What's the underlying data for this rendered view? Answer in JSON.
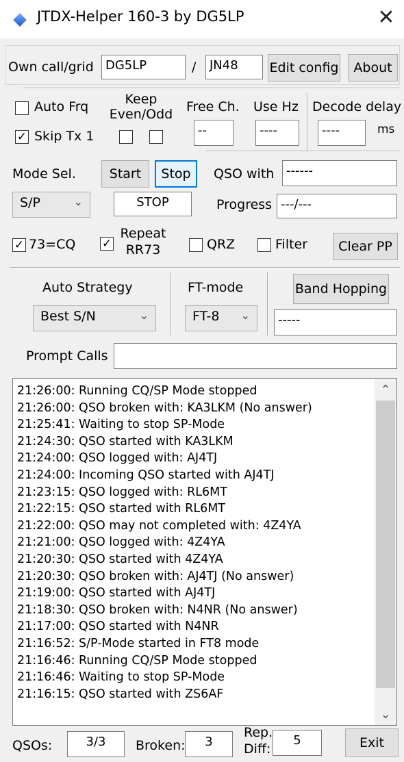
{
  "window": {
    "title": "JTDX-Helper 160-3 by DG5LP",
    "close_glyph": "✕",
    "app_icon": "diamond-icon"
  },
  "own": {
    "label": "Own call/grid",
    "call": "DG5LP",
    "slash": "/",
    "grid": "JN48",
    "edit_config": "Edit config",
    "about": "About"
  },
  "settings": {
    "auto_frq": "Auto Frq",
    "auto_frq_checked": false,
    "skip_tx1": "Skip Tx 1",
    "skip_tx1_checked": true,
    "keep_line1": "Keep",
    "keep_line2": "Even/Odd",
    "free_ch_label": "Free Ch.",
    "free_ch_value": "--",
    "use_hz_label": "Use Hz",
    "use_hz_value": "----",
    "decode_delay_label": "Decode delay",
    "decode_delay_value": "----",
    "decode_delay_unit": "ms"
  },
  "mode": {
    "label": "Mode Sel.",
    "start": "Start",
    "stop": "Stop",
    "qso_with_label": "QSO with",
    "qso_with_value": "------",
    "selected": "S/P",
    "status": "STOP",
    "progress_label": "Progress",
    "progress_value": "---/---"
  },
  "options": {
    "cq73": "73=CQ",
    "cq73_checked": true,
    "repeat_line1": "Repeat",
    "repeat_line2": "RR73",
    "repeat_checked": true,
    "qrz": "QRZ",
    "qrz_checked": false,
    "filter": "Filter",
    "filter_checked": false,
    "clear_pp": "Clear PP"
  },
  "strategy": {
    "auto_strategy_label": "Auto Strategy",
    "auto_strategy_value": "Best S/N",
    "ft_mode_label": "FT-mode",
    "ft_mode_value": "FT-8",
    "band_hopping": "Band Hopping",
    "band_value": "-----",
    "prompt_calls_label": "Prompt Calls",
    "prompt_calls_value": ""
  },
  "log": [
    "21:26:00: Running CQ/SP Mode stopped",
    "21:26:00: QSO broken with: KA3LKM (No answer)",
    "21:25:41: Waiting to stop SP-Mode",
    "21:24:30: QSO started with KA3LKM",
    "21:24:00: QSO logged with: AJ4TJ",
    "21:24:00: Incoming QSO started with AJ4TJ",
    "21:23:15: QSO logged with: RL6MT",
    "21:22:15: QSO started with RL6MT",
    "21:22:00: QSO may not completed with:  4Z4YA",
    "21:21:00: QSO logged with: 4Z4YA",
    "21:20:30: QSO started with 4Z4YA",
    "21:20:30: QSO broken with: AJ4TJ (No answer)",
    "21:19:00: QSO started with AJ4TJ",
    "21:18:30: QSO broken with: N4NR (No answer)",
    "21:17:00: QSO started with N4NR",
    "21:16:52: S/P-Mode started in FT8 mode",
    "21:16:46: Running CQ/SP Mode stopped",
    "21:16:46: Waiting to stop SP-Mode",
    "21:16:15: QSO started with ZS6AF"
  ],
  "footer": {
    "qsos_label": "QSOs:",
    "qsos_value": "3/3",
    "broken_label": "Broken:",
    "broken_value": "3",
    "rep_diff_line1": "Rep.",
    "rep_diff_line2": "Diff:",
    "rep_diff_value": "5",
    "exit": "Exit"
  },
  "icons": {
    "check": "✓",
    "dropdown": "chevron-down-icon",
    "scroll_up": "chevron-up-icon",
    "scroll_down": "chevron-down-icon"
  },
  "colors": {
    "focus_border": "#0078d7",
    "window_bg": "#f0f0f0",
    "title_bg": "#ffffff"
  }
}
